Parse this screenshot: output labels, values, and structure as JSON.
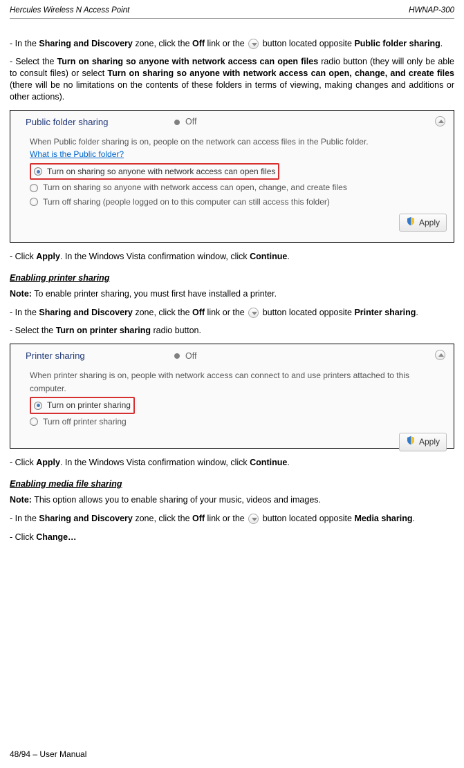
{
  "header": {
    "left": "Hercules Wireless N Access Point",
    "right": "HWNAP-300"
  },
  "p1_a": "- In the ",
  "p1_b": "Sharing and Discovery",
  "p1_c": " zone, click the ",
  "p1_d": "Off",
  "p1_e": " link or the ",
  "p1_f": " button located opposite ",
  "p1_g": "Public folder sharing",
  "p1_h": ".",
  "p2_a": "- Select the ",
  "p2_b": "Turn on sharing so anyone with network access can open files",
  "p2_c": " radio button (they will only be able to consult files) or select ",
  "p2_d": "Turn on sharing so anyone with network access can open, change, and create files",
  "p2_e": " (there will be no limitations on the contents of these folders in terms of viewing, making changes and additions or other actions).",
  "sb1": {
    "title": "Public folder sharing",
    "off": "Off",
    "desc": "When Public folder sharing is on, people on the network can access files in the Public folder.",
    "link": "What is the Public folder?",
    "r1": "Turn on sharing so anyone with network access can open files",
    "r2": "Turn on sharing so anyone with network access can open, change, and create files",
    "r3": "Turn off sharing (people logged on to this computer can still access this folder)",
    "apply": "Apply"
  },
  "p3_a": "- Click ",
  "p3_b": "Apply",
  "p3_c": ".  In the Windows Vista confirmation window, click ",
  "p3_d": "Continue",
  "p3_e": ".",
  "h1": "Enabling printer sharing",
  "p4_a": "Note:",
  "p4_b": " To enable printer sharing, you must first have installed a printer.",
  "p5_a": "- In the ",
  "p5_b": "Sharing and Discovery",
  "p5_c": " zone, click the ",
  "p5_d": "Off",
  "p5_e": " link or the ",
  "p5_f": " button located opposite ",
  "p5_g": "Printer sharing",
  "p5_h": ".",
  "p6_a": "- Select the ",
  "p6_b": "Turn on printer sharing",
  "p6_c": " radio button.",
  "sb2": {
    "title": "Printer sharing",
    "off": "Off",
    "desc": "When printer sharing is on, people with network access can connect to and use printers attached to this computer.",
    "r1": "Turn on printer sharing",
    "r2": "Turn off printer sharing",
    "apply": "Apply"
  },
  "p7_a": "- Click ",
  "p7_b": "Apply",
  "p7_c": ".  In the Windows Vista confirmation window, click ",
  "p7_d": "Continue",
  "p7_e": ".",
  "h2": "Enabling media file sharing",
  "p8_a": "Note:",
  "p8_b": " This option allows you to enable sharing of your music, videos and images.",
  "p9_a": "- In the ",
  "p9_b": "Sharing and Discovery",
  "p9_c": " zone, click the ",
  "p9_d": "Off",
  "p9_e": " link or the ",
  "p9_f": " button located opposite ",
  "p9_g": "Media sharing",
  "p9_h": ".",
  "p10_a": "- Click ",
  "p10_b": "Change…",
  "footer": "48/94 – User Manual"
}
